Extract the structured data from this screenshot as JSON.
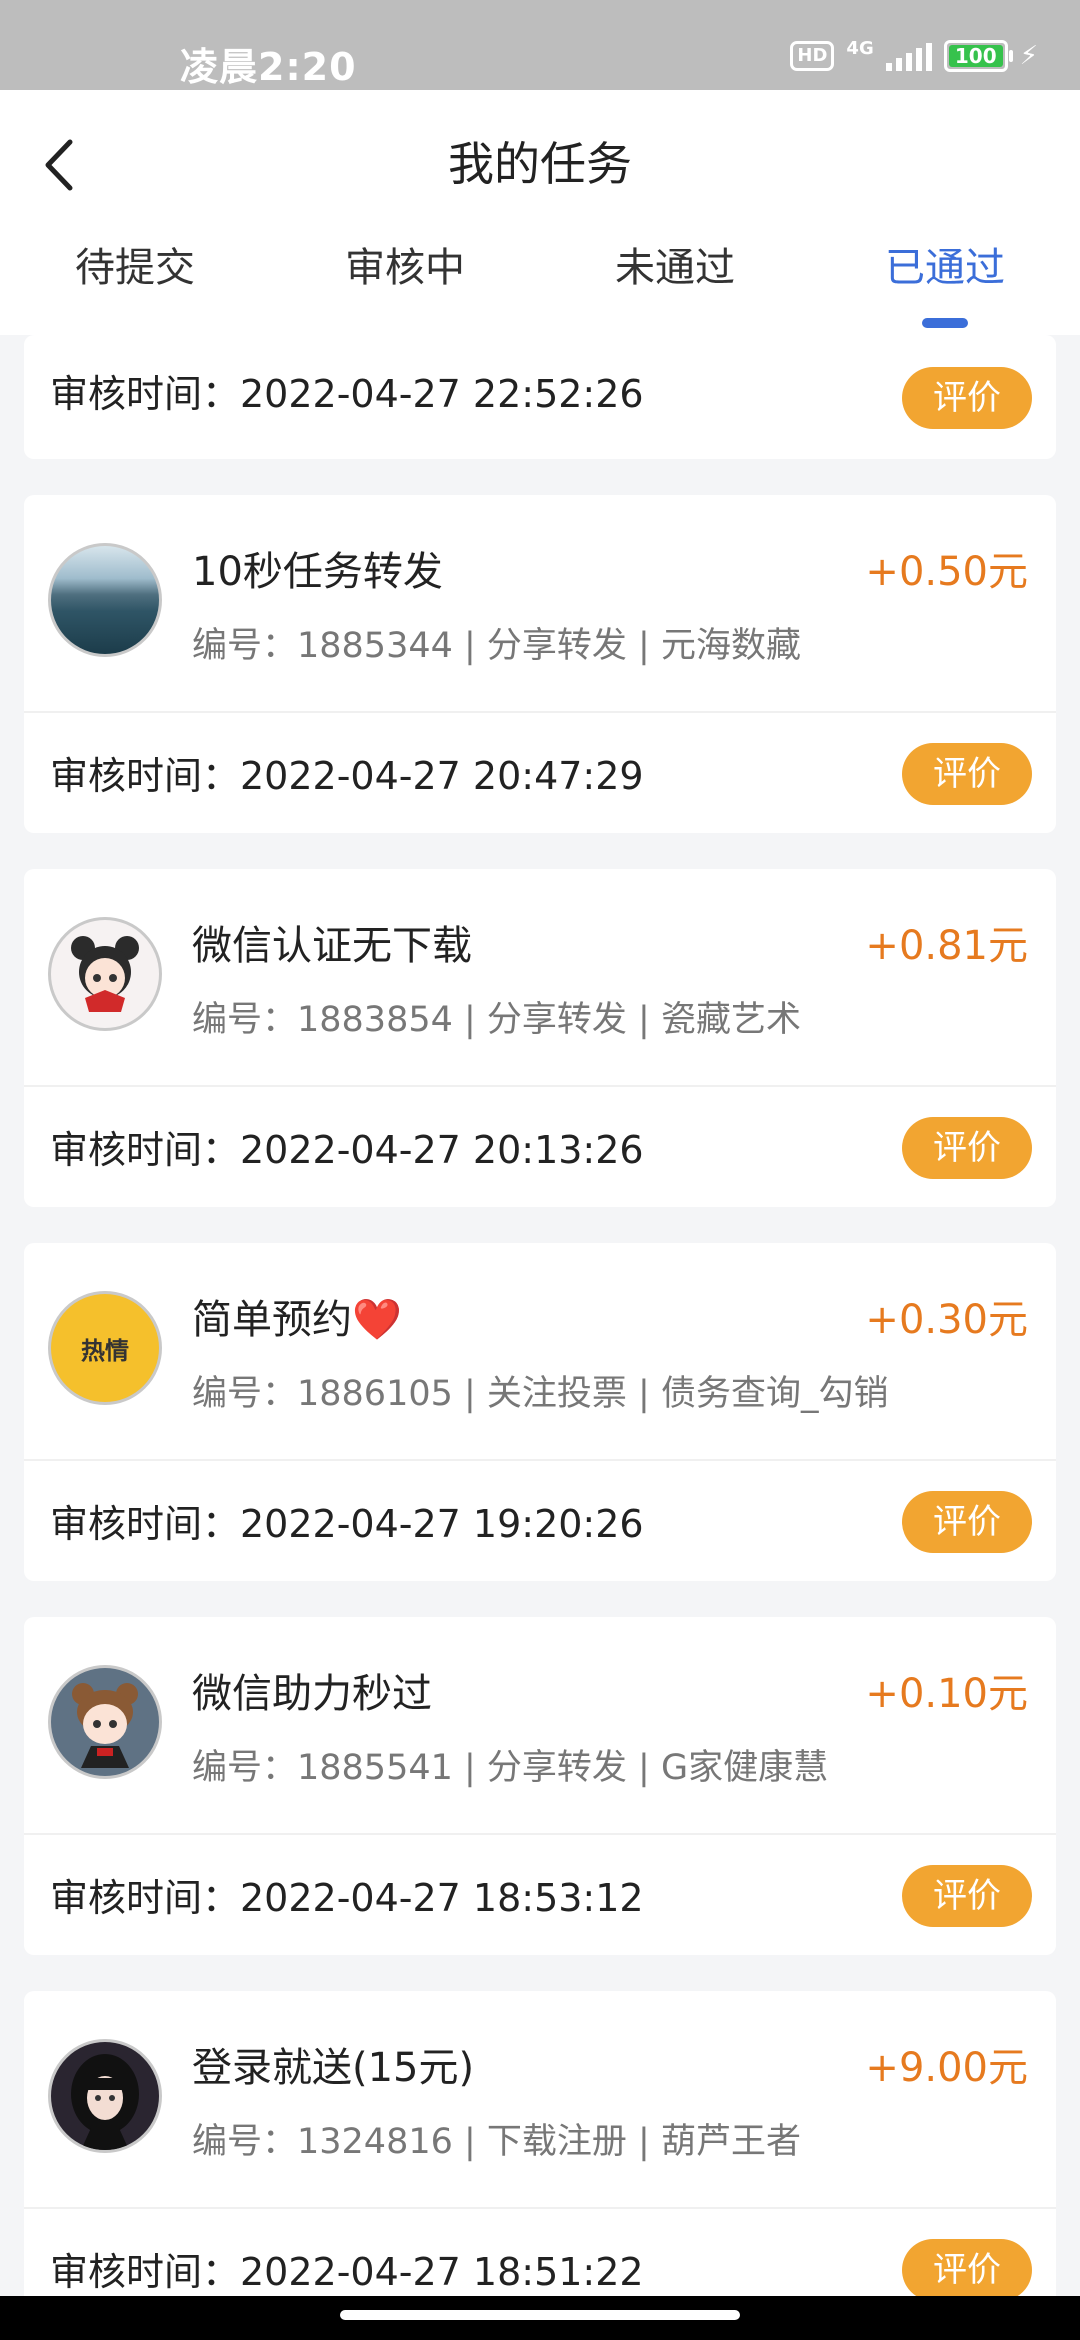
{
  "status_bar": {
    "time": "凌晨2:20",
    "hd": "HD",
    "network": "4G",
    "battery": "100"
  },
  "header": {
    "title": "我的任务"
  },
  "tabs": [
    {
      "label": "待提交"
    },
    {
      "label": "审核中"
    },
    {
      "label": "未通过"
    },
    {
      "label": "已通过",
      "active": true
    }
  ],
  "partial_card": {
    "review_time": "审核时间：2022-04-27 22:52:26",
    "rate_label": "评价"
  },
  "tasks": [
    {
      "name": "10秒任务转发",
      "reward": "+0.50元",
      "meta": "编号：1885344 | 分享转发 | 元海数藏",
      "review_time": "审核时间：2022-04-27 20:47:29",
      "rate_label": "评价",
      "avatar": "landscape-avatar"
    },
    {
      "name": "微信认证无下载",
      "reward": "+0.81元",
      "meta": "编号：1883854 | 分享转发 | 瓷藏艺术",
      "review_time": "审核时间：2022-04-27 20:13:26",
      "rate_label": "评价",
      "avatar": "cartoon-girl-avatar"
    },
    {
      "name": "简单预约",
      "name_emoji": "❤️",
      "reward": "+0.30元",
      "meta": "编号：1886105 | 关注投票 | 债务查询_勾销",
      "review_time": "审核时间：2022-04-27 19:20:26",
      "rate_label": "评价",
      "avatar": "hot-badge-avatar",
      "avatar_text": "热情"
    },
    {
      "name": "微信助力秒过",
      "reward": "+0.10元",
      "meta": "编号：1885541 | 分享转发 | G家健康慧",
      "review_time": "审核时间：2022-04-27 18:53:12",
      "rate_label": "评价",
      "avatar": "cartoon-boy-avatar"
    },
    {
      "name": "登录就送(15元)",
      "reward": "+9.00元",
      "meta": "编号：1324816 | 下载注册 | 葫芦王者",
      "review_time": "审核时间：2022-04-27 18:51:22",
      "rate_label": "评价",
      "avatar": "photo-girl-avatar"
    }
  ],
  "colors": {
    "accent": "#3b6ed9",
    "reward": "#e67a1f",
    "rate_button": "#f2a531"
  }
}
